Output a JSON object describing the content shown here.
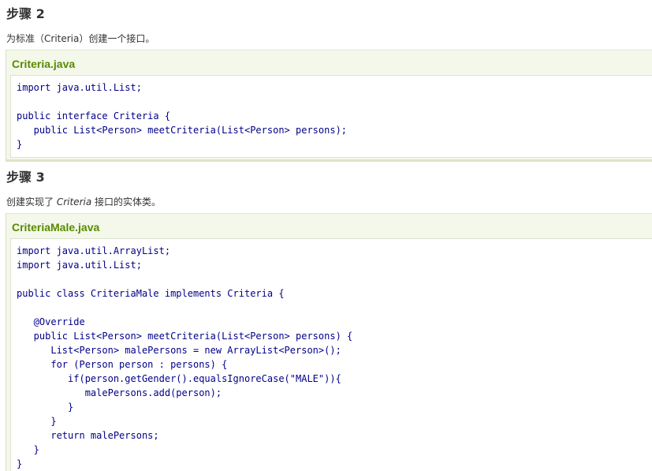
{
  "step2": {
    "heading": "步骤 2",
    "description": "为标准（Criteria）创建一个接口。",
    "file_title": "Criteria.java",
    "code_lines": [
      "import java.util.List;",
      "",
      "public interface Criteria {",
      "   public List<Person> meetCriteria(List<Person> persons);",
      "}"
    ]
  },
  "step3": {
    "heading": "步骤 3",
    "description_before": "创建实现了 ",
    "description_italic": "Criteria",
    "description_after": " 接口的实体类。",
    "file_title": "CriteriaMale.java",
    "code_lines": [
      "import java.util.ArrayList;",
      "import java.util.List;",
      "",
      "public class CriteriaMale implements Criteria {",
      "",
      "   @Override",
      "   public List<Person> meetCriteria(List<Person> persons) {",
      "      List<Person> malePersons = new ArrayList<Person>();",
      "      for (Person person : persons) {",
      "         if(person.getGender().equalsIgnoreCase(\"MALE\")){",
      "            malePersons.add(person);",
      "         }",
      "      }",
      "      return malePersons;",
      "   }",
      "}"
    ]
  }
}
